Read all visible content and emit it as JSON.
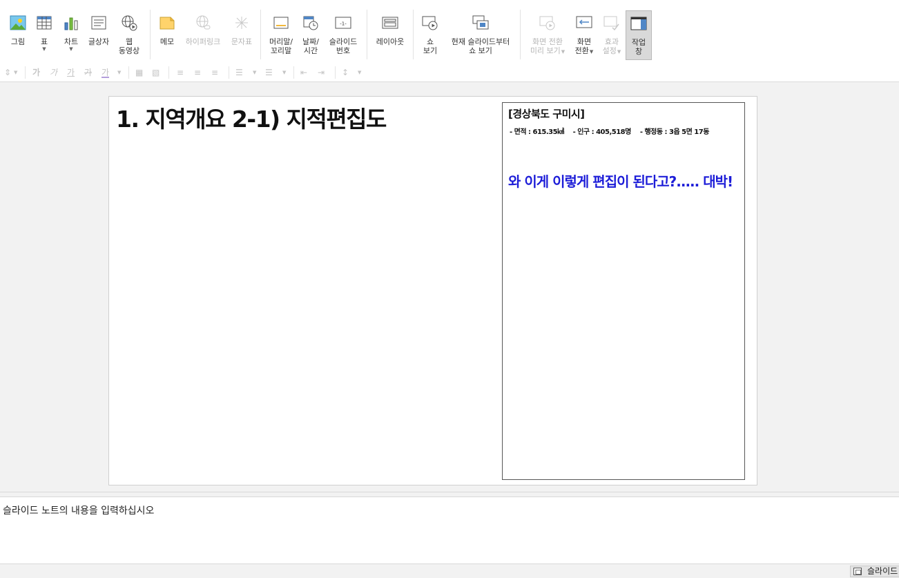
{
  "ribbon": {
    "buttons": [
      {
        "id": "picture",
        "label": "그림",
        "caret": false,
        "disabled": false
      },
      {
        "id": "table",
        "label": "표",
        "caret": true,
        "disabled": false
      },
      {
        "id": "chart",
        "label": "차트",
        "caret": true,
        "disabled": false
      },
      {
        "id": "textbox",
        "label": "글상자",
        "caret": false,
        "disabled": false
      },
      {
        "id": "web-video",
        "label": "웹\n동영상",
        "caret": false,
        "disabled": false
      },
      {
        "id": "memo",
        "label": "메모",
        "caret": false,
        "disabled": false
      },
      {
        "id": "hyperlink",
        "label": "하이퍼링크",
        "caret": false,
        "disabled": true
      },
      {
        "id": "symbol",
        "label": "문자표",
        "caret": false,
        "disabled": true
      },
      {
        "id": "header-footer",
        "label": "머리말/\n꼬리말",
        "caret": false,
        "disabled": false
      },
      {
        "id": "date-time",
        "label": "날짜/\n시간",
        "caret": false,
        "disabled": false
      },
      {
        "id": "slide-number",
        "label": "슬라이드\n번호",
        "caret": false,
        "disabled": false
      },
      {
        "id": "layout",
        "label": "레이아웃",
        "caret": false,
        "disabled": false
      },
      {
        "id": "show",
        "label": "쇼\n보기",
        "caret": false,
        "disabled": false
      },
      {
        "id": "show-from-current",
        "label": "현재 슬라이드부터\n쇼 보기",
        "caret": false,
        "disabled": false
      },
      {
        "id": "transition-preview",
        "label": "화면 전환\n미리 보기",
        "caret": true,
        "disabled": true
      },
      {
        "id": "transition",
        "label": "화면\n전환",
        "caret": true,
        "disabled": false
      },
      {
        "id": "effect-settings",
        "label": "효과\n설정",
        "caret": true,
        "disabled": true
      },
      {
        "id": "task-pane",
        "label": "작업\n창",
        "caret": false,
        "disabled": false,
        "active": true
      }
    ]
  },
  "formatbar": {
    "glyphs": [
      "가",
      "가",
      "가",
      "가",
      "가"
    ]
  },
  "slide": {
    "title": "1. 지역개요  2-1) 지적편집도",
    "infobox": {
      "heading": "[경상북도 구미시]",
      "stats": [
        "- 면적 : 615.35㎢",
        "- 인구 : 405,518명",
        "- 행정동 : 3읍 5면 17동"
      ],
      "note": "와 이게 이렇게 편집이 된다고?..... 대박!"
    }
  },
  "notes": {
    "placeholder": "슬라이드 노트의 내용을 입력하십시오"
  },
  "statusbar": {
    "slide_label": "슬라이드"
  },
  "colors": {
    "note_text": "#1d1dd8",
    "active_button": "#d9d9d9"
  }
}
